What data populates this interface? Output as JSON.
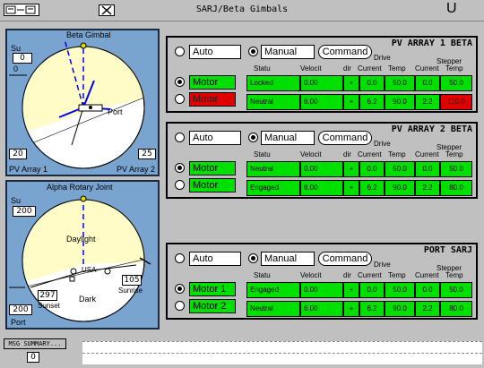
{
  "window": {
    "title": "SARJ/Beta Gimbals",
    "u_label": "U"
  },
  "beta_gimbal": {
    "title": "Beta Gimbal",
    "su_label": "Su",
    "su_value": "0",
    "su_value2": "0",
    "port_label": "Port",
    "left_value": "20",
    "right_value": "25",
    "left_array_label": "PV Array 1",
    "right_array_label": "PV Array 2"
  },
  "alpha_joint": {
    "title": "Alpha Rotary Joint",
    "su_label": "Su",
    "su_value": "200",
    "daylight_label": "Daylight",
    "dark_label": "Dark",
    "usa_label": "USA",
    "sunset_value": "297",
    "sunset_label": "Sunset",
    "sunrise_value": "105",
    "sunrise_label": "Sunrise",
    "port_value": "200",
    "port_label": "Port"
  },
  "headers": {
    "status": "Statu",
    "velocity": "Velocit",
    "dir": "dir",
    "current": "Current",
    "temp": "Temp",
    "drive": "Drive",
    "stepper": "Stepper"
  },
  "panels": [
    {
      "title": "PV ARRAY 1 BETA",
      "auto": "Auto",
      "manual": "Manual",
      "command": "Command",
      "motor1": "Motor",
      "motor2": "Motor",
      "rows": [
        {
          "status": "Locked",
          "velocity": "0.00",
          "dir": "+",
          "cur1": "0.0",
          "temp1": "50.0",
          "cur2": "0.0",
          "temp2": "50.0"
        },
        {
          "status": "Neutral",
          "velocity": "6.00",
          "dir": "+",
          "cur1": "6.2",
          "temp1": "90.0",
          "cur2": "2.2",
          "temp2": "110.0"
        }
      ]
    },
    {
      "title": "PV ARRAY 2 BETA",
      "auto": "Auto",
      "manual": "Manual",
      "command": "Command",
      "motor1": "Motor",
      "motor2": "Motor",
      "rows": [
        {
          "status": "Neutral",
          "velocity": "0.00",
          "dir": "+",
          "cur1": "0.0",
          "temp1": "50.0",
          "cur2": "0.0",
          "temp2": "50.0"
        },
        {
          "status": "Engaged",
          "velocity": "6.00",
          "dir": "+",
          "cur1": "6.2",
          "temp1": "90.0",
          "cur2": "2.2",
          "temp2": "80.0"
        }
      ]
    },
    {
      "title": "PORT SARJ",
      "auto": "Auto",
      "manual": "Manual",
      "command": "Command",
      "motor1": "Motor 1",
      "motor2": "Motor 2",
      "rows": [
        {
          "status": "Engaged",
          "velocity": "0.00",
          "dir": "+",
          "cur1": "0.0",
          "temp1": "50.0",
          "cur2": "0.0",
          "temp2": "50.0"
        },
        {
          "status": "Neutral",
          "velocity": "6.00",
          "dir": "+",
          "cur1": "6.2",
          "temp1": "90.0",
          "cur2": "2.2",
          "temp2": "80.0"
        }
      ]
    }
  ],
  "msg": {
    "button": "MSG SUMMARY...",
    "count": "0"
  },
  "colors": {
    "green": "#00e000",
    "red": "#e00000",
    "daylight": "#fffcc8",
    "panel_blue": "#7aa4d0"
  }
}
